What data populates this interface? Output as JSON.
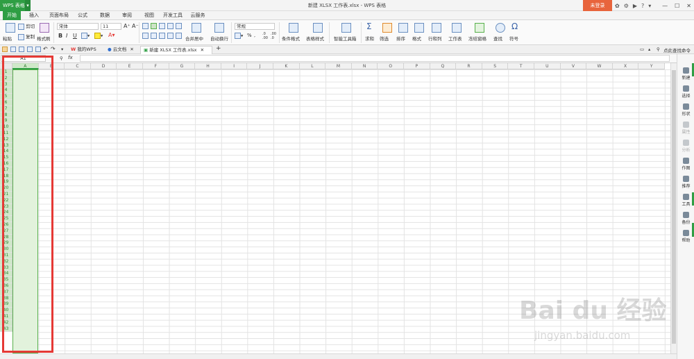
{
  "app": {
    "name": "WPS 表格",
    "caret": "▾",
    "window_title": "新建 XLSX 工作表.xlsx - WPS 表格",
    "login_label": "未登录"
  },
  "window_controls": {
    "minimize": "—",
    "maximize": "☐",
    "close": "✕"
  },
  "ribbon_tabs": [
    "开始",
    "插入",
    "页面布局",
    "公式",
    "数据",
    "审阅",
    "视图",
    "开发工具",
    "云服务"
  ],
  "ribbon": {
    "paste": "粘贴",
    "cut": "剪切",
    "copy": "复制",
    "format_painter": "格式刷",
    "font_name": "宋体",
    "font_size": "11",
    "bold": "B",
    "italic": "I",
    "underline": "U",
    "merge_center": "合并居中",
    "wrap_text": "自动换行",
    "number_format": "常规",
    "percent": "%",
    "conditional_format": "条件格式",
    "table_style": "表格样式",
    "smart_toolbox": "智能工具箱",
    "sum": "求和",
    "filter": "筛选",
    "sort": "排序",
    "format": "格式",
    "row_col": "行和列",
    "worksheet": "工作表",
    "freeze": "冻结窗格",
    "find": "查找",
    "symbol": "符号"
  },
  "doc_tabs": [
    {
      "label": "我的WPS"
    },
    {
      "label": "云文档"
    },
    {
      "label": "新建 XLSX 工作表.xlsx"
    }
  ],
  "add_tab": "+",
  "search_command": "点此查找命令",
  "formula": {
    "namebox": "A1",
    "fx": "fx"
  },
  "columns": [
    "A",
    "B",
    "C",
    "D",
    "E",
    "F",
    "G",
    "H",
    "I",
    "J",
    "K",
    "L",
    "M",
    "N",
    "O",
    "P",
    "Q",
    "R",
    "S",
    "T",
    "U",
    "V",
    "W",
    "X",
    "Y"
  ],
  "selected_column": "A",
  "rows": [
    "1",
    "2",
    "3",
    "4",
    "5",
    "6",
    "7",
    "8",
    "9",
    "10",
    "11",
    "12",
    "13",
    "14",
    "15",
    "16",
    "17",
    "18",
    "19",
    "20",
    "21",
    "22",
    "23",
    "24",
    "25",
    "26",
    "27",
    "28",
    "29",
    "30",
    "31",
    "32",
    "33",
    "34",
    "35",
    "36",
    "37",
    "38",
    "39",
    "40",
    "41",
    "42",
    "43"
  ],
  "side_panel": [
    {
      "label": "新建",
      "enabled": true
    },
    {
      "label": "选择",
      "enabled": true
    },
    {
      "label": "形状",
      "enabled": true
    },
    {
      "label": "属性",
      "enabled": false
    },
    {
      "label": "分析",
      "enabled": false
    },
    {
      "label": "作图",
      "enabled": true
    },
    {
      "label": "推荐",
      "enabled": true
    },
    {
      "label": "工具",
      "enabled": true
    },
    {
      "label": "备份",
      "enabled": true
    },
    {
      "label": "帮助",
      "enabled": true
    }
  ],
  "watermark": {
    "brand": "Bai du 经验",
    "url": "jingyan.baidu.com"
  },
  "colors": {
    "accent": "#2f9e44",
    "login": "#e8643c",
    "highlight_box": "#e53935",
    "selection_fill": "#e2f2dc"
  }
}
